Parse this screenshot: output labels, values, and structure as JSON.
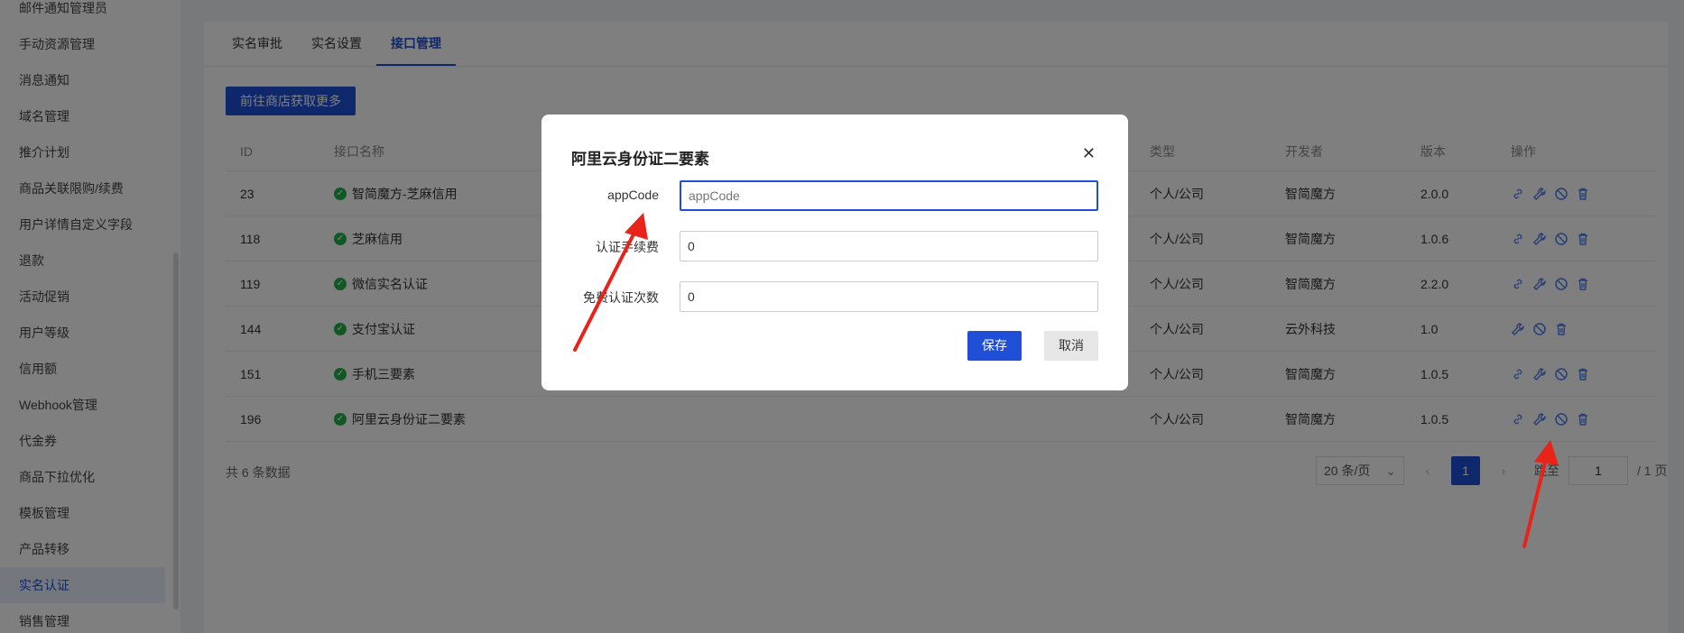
{
  "sidebar": {
    "items": [
      {
        "label": "邮件通知管理员"
      },
      {
        "label": "手动资源管理"
      },
      {
        "label": "消息通知"
      },
      {
        "label": "域名管理"
      },
      {
        "label": "推介计划"
      },
      {
        "label": "商品关联限购/续费"
      },
      {
        "label": "用户详情自定义字段"
      },
      {
        "label": "退款"
      },
      {
        "label": "活动促销"
      },
      {
        "label": "用户等级"
      },
      {
        "label": "信用额"
      },
      {
        "label": "Webhook管理"
      },
      {
        "label": "代金券"
      },
      {
        "label": "商品下拉优化"
      },
      {
        "label": "模板管理"
      },
      {
        "label": "产品转移"
      },
      {
        "label": "实名认证"
      },
      {
        "label": "销售管理"
      }
    ],
    "active_index": 16
  },
  "tabs": [
    {
      "label": "实名审批"
    },
    {
      "label": "实名设置"
    },
    {
      "label": "接口管理"
    }
  ],
  "active_tab": 2,
  "shop_button": "前往商店获取更多",
  "table": {
    "headers": {
      "id": "ID",
      "name": "接口名称",
      "type": "类型",
      "developer": "开发者",
      "version": "版本",
      "ops": "操作"
    },
    "rows": [
      {
        "id": "23",
        "name": "智简魔方-芝麻信用",
        "type": "个人/公司",
        "developer": "智简魔方",
        "version": "2.0.0",
        "has_link": true
      },
      {
        "id": "118",
        "name": "芝麻信用",
        "type": "个人/公司",
        "developer": "智简魔方",
        "version": "1.0.6",
        "has_link": true
      },
      {
        "id": "119",
        "name": "微信实名认证",
        "type": "个人/公司",
        "developer": "智简魔方",
        "version": "2.2.0",
        "has_link": true
      },
      {
        "id": "144",
        "name": "支付宝认证",
        "type": "个人/公司",
        "developer": "云外科技",
        "version": "1.0",
        "has_link": false
      },
      {
        "id": "151",
        "name": "手机三要素",
        "type": "个人/公司",
        "developer": "智简魔方",
        "version": "1.0.5",
        "has_link": true
      },
      {
        "id": "196",
        "name": "阿里云身份证二要素",
        "type": "个人/公司",
        "developer": "智简魔方",
        "version": "1.0.5",
        "has_link": true
      }
    ]
  },
  "footer": {
    "total": "共 6 条数据",
    "page_size": "20 条/页",
    "prev": "‹",
    "current_page": "1",
    "next": "›",
    "jump_label": "跳至",
    "jump_value": "1",
    "total_pages": "/ 1 页"
  },
  "modal": {
    "title": "阿里云身份证二要素",
    "close": "✕",
    "fields": [
      {
        "label": "appCode",
        "value": "",
        "placeholder": "appCode"
      },
      {
        "label": "认证手续费",
        "value": "0",
        "placeholder": ""
      },
      {
        "label": "免费认证次数",
        "value": "0",
        "placeholder": ""
      }
    ],
    "save": "保存",
    "cancel": "取消"
  },
  "colors": {
    "primary": "#1f4fd6",
    "success": "#22b04b",
    "annotation": "#e8231a"
  }
}
